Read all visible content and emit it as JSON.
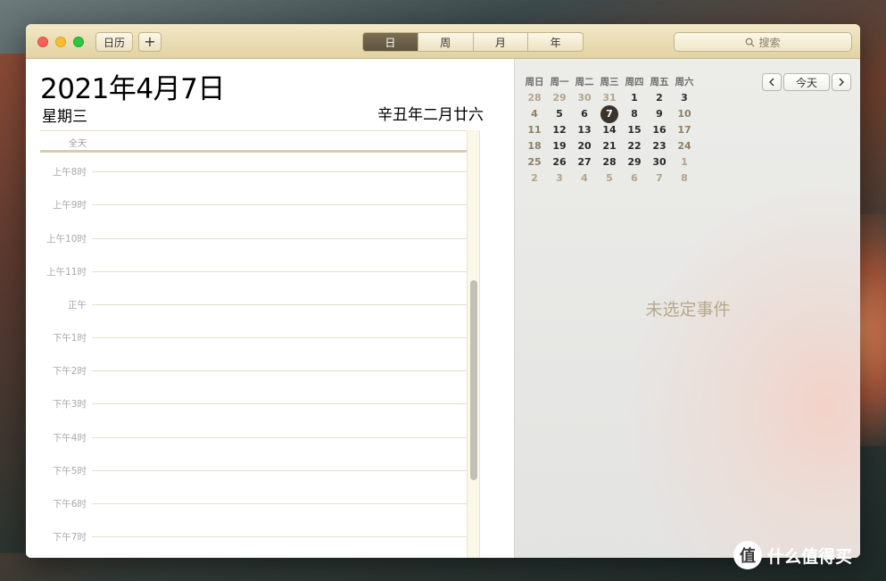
{
  "toolbar": {
    "calendars_label": "日历",
    "add_label": "+",
    "view_tabs": [
      {
        "label": "日",
        "active": true
      },
      {
        "label": "周",
        "active": false
      },
      {
        "label": "月",
        "active": false
      },
      {
        "label": "年",
        "active": false
      }
    ],
    "search_placeholder": "搜索"
  },
  "day_view": {
    "date_title": "2021年4月7日",
    "weekday": "星期三",
    "lunar_date": "辛丑年二月廿六",
    "allday_label": "全天",
    "hours": [
      "上午8时",
      "上午9时",
      "上午10时",
      "上午11时",
      "正午",
      "下午1时",
      "下午2时",
      "下午3时",
      "下午4时",
      "下午5时",
      "下午6时",
      "下午7时"
    ]
  },
  "mini_calendar": {
    "weekday_headers": [
      "周日",
      "周一",
      "周二",
      "周三",
      "周四",
      "周五",
      "周六"
    ],
    "weeks": [
      [
        "28",
        "29",
        "30",
        "31",
        "1",
        "2",
        "3"
      ],
      [
        "4",
        "5",
        "6",
        "7",
        "8",
        "9",
        "10"
      ],
      [
        "11",
        "12",
        "13",
        "14",
        "15",
        "16",
        "17"
      ],
      [
        "18",
        "19",
        "20",
        "21",
        "22",
        "23",
        "24"
      ],
      [
        "25",
        "26",
        "27",
        "28",
        "29",
        "30",
        "1"
      ],
      [
        "2",
        "3",
        "4",
        "5",
        "6",
        "7",
        "8"
      ]
    ],
    "selected_day": "7",
    "today_label": "今天"
  },
  "inspector": {
    "empty_label": "未选定事件"
  },
  "watermark": {
    "text": "什么值得买",
    "logo_glyph": "值"
  },
  "colors": {
    "titlebar": "#e2d3a3",
    "active_tab": "#6b5f49",
    "today_circle": "#3a342b",
    "hour_label": "#a8a8a8",
    "placeholder_text": "#b6a98a"
  }
}
